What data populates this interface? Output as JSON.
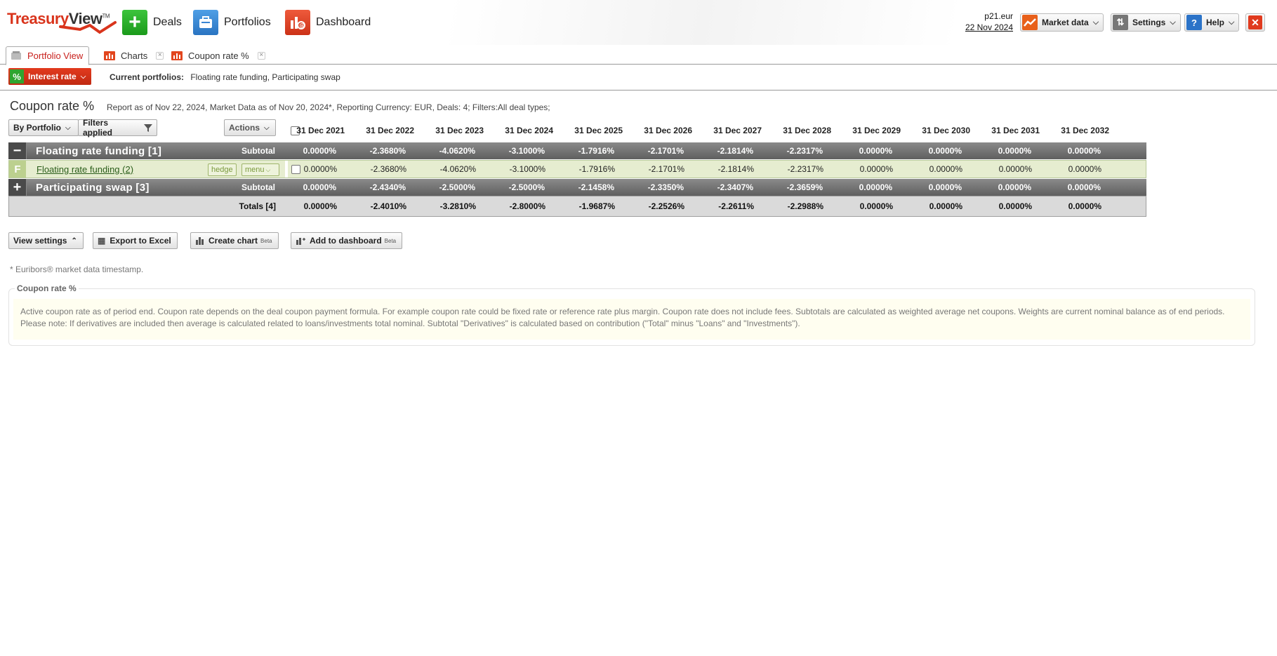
{
  "app": {
    "logo_part1": "Treasury",
    "logo_part2": "View",
    "logo_tm": "TM",
    "nav": [
      {
        "label": "Deals",
        "icon": "plus-icon"
      },
      {
        "label": "Portfolios",
        "icon": "briefcase-icon"
      },
      {
        "label": "Dashboard",
        "icon": "dashboard-chart-icon"
      }
    ],
    "user": "p21.eur",
    "date": "22 Nov 2024",
    "toolbar": {
      "market_data": "Market data",
      "settings": "Settings",
      "help": "Help",
      "close_icon": "✕"
    }
  },
  "tabs": [
    {
      "label": "Portfolio View",
      "active": true
    },
    {
      "label": "Charts",
      "active": false
    },
    {
      "label": "Coupon rate %",
      "active": false
    }
  ],
  "subbar": {
    "interest_rate": "Interest rate",
    "current_label": "Current portfolios:",
    "current_value": "Floating rate funding, Participating swap"
  },
  "report": {
    "title": "Coupon rate %",
    "info": "Report as of Nov 22, 2024, Market Data as of Nov 20, 2024*, Reporting Currency: EUR, Deals: 4; Filters:All deal types;"
  },
  "controls": {
    "by_portfolio": "By Portfolio",
    "filters": "Filters applied",
    "actions": "Actions"
  },
  "table": {
    "columns": [
      "31 Dec 2021",
      "31 Dec 2022",
      "31 Dec 2023",
      "31 Dec 2024",
      "31 Dec 2025",
      "31 Dec 2026",
      "31 Dec 2027",
      "31 Dec 2028",
      "31 Dec 2029",
      "31 Dec 2030",
      "31 Dec 2031",
      "31 Dec 2032"
    ],
    "group1": {
      "toggle": "−",
      "name": "Floating rate funding [1]",
      "subtotal_label": "Subtotal",
      "values": [
        "0.0000%",
        "-2.3680%",
        "-4.0620%",
        "-3.1000%",
        "-1.7916%",
        "-2.1701%",
        "-2.1814%",
        "-2.2317%",
        "0.0000%",
        "0.0000%",
        "0.0000%",
        "0.0000%"
      ]
    },
    "detail1": {
      "type_letter": "F",
      "name": "Floating rate funding (2)",
      "hedge": "hedge",
      "menu": "menu",
      "values": [
        "0.0000%",
        "-2.3680%",
        "-4.0620%",
        "-3.1000%",
        "-1.7916%",
        "-2.1701%",
        "-2.1814%",
        "-2.2317%",
        "0.0000%",
        "0.0000%",
        "0.0000%",
        "0.0000%"
      ]
    },
    "group2": {
      "toggle": "+",
      "name": "Participating swap [3]",
      "subtotal_label": "Subtotal",
      "values": [
        "0.0000%",
        "-2.4340%",
        "-2.5000%",
        "-2.5000%",
        "-2.1458%",
        "-2.3350%",
        "-2.3407%",
        "-2.3659%",
        "0.0000%",
        "0.0000%",
        "0.0000%",
        "0.0000%"
      ]
    },
    "totals": {
      "label": "Totals [4]",
      "values": [
        "0.0000%",
        "-2.4010%",
        "-3.2810%",
        "-2.8000%",
        "-1.9687%",
        "-2.2526%",
        "-2.2611%",
        "-2.2988%",
        "0.0000%",
        "0.0000%",
        "0.0000%",
        "0.0000%"
      ]
    }
  },
  "actions": {
    "view_settings": "View settings",
    "export_excel": "Export to Excel",
    "create_chart": "Create chart",
    "add_dashboard": "Add to dashboard",
    "beta": "Beta"
  },
  "footnote": "* Euribors® market data timestamp.",
  "description": {
    "legend": "Coupon rate %",
    "text": "Active coupon rate as of period end. Coupon rate depends on the deal coupon payment formula. For example coupon rate could be fixed rate or reference rate plus margin. Coupon rate does not include fees. Subtotals are calculated as weighted average net coupons. Weights are current nominal balance as of end periods. Please note: If derivatives are included then average is calculated related to loans/investments total nominal. Subtotal \"Derivatives\" is calculated based on contribution (\"Total\" minus \"Loans\" and \"Investments\")."
  }
}
